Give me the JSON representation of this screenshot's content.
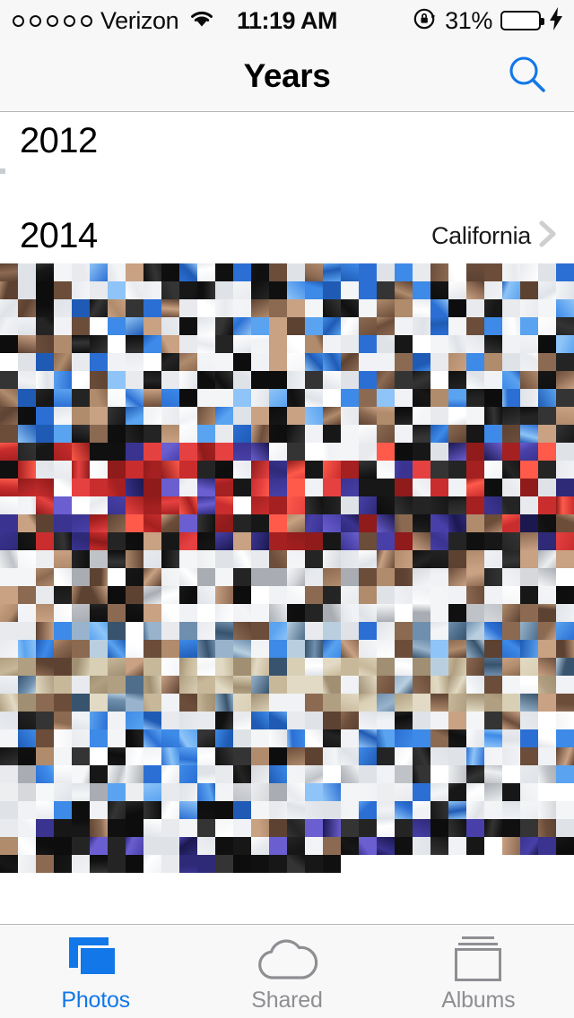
{
  "status_bar": {
    "signal_dots": 5,
    "signal_filled": 0,
    "carrier": "Verizon",
    "wifi_icon": "wifi-icon",
    "time": "11:19 AM",
    "rotation_lock_icon": "rotation-lock-icon",
    "battery_percent": "31%",
    "battery_level": 31,
    "battery_color": "#4cd750",
    "charging_icon": "charging-bolt-icon"
  },
  "nav_bar": {
    "title": "Years",
    "search_icon": "search-icon",
    "search_color": "#1277e8"
  },
  "years": [
    {
      "label": "2012",
      "place": "",
      "has_chevron": false,
      "thumb_size": 6,
      "columns": 1,
      "rows": 1,
      "seed": 11
    },
    {
      "label": "2014",
      "place": "California",
      "has_chevron": true,
      "thumb_size": 20,
      "columns": 32,
      "rows": 34,
      "last_row_count": 19,
      "seed": 2014
    }
  ],
  "tab_bar": {
    "tabs": [
      {
        "label": "Photos",
        "icon": "photos-stack-icon",
        "active": true
      },
      {
        "label": "Shared",
        "icon": "cloud-icon",
        "active": false
      },
      {
        "label": "Albums",
        "icon": "albums-stack-icon",
        "active": false
      }
    ],
    "active_color": "#1277e8",
    "inactive_color": "#8e8e93"
  }
}
